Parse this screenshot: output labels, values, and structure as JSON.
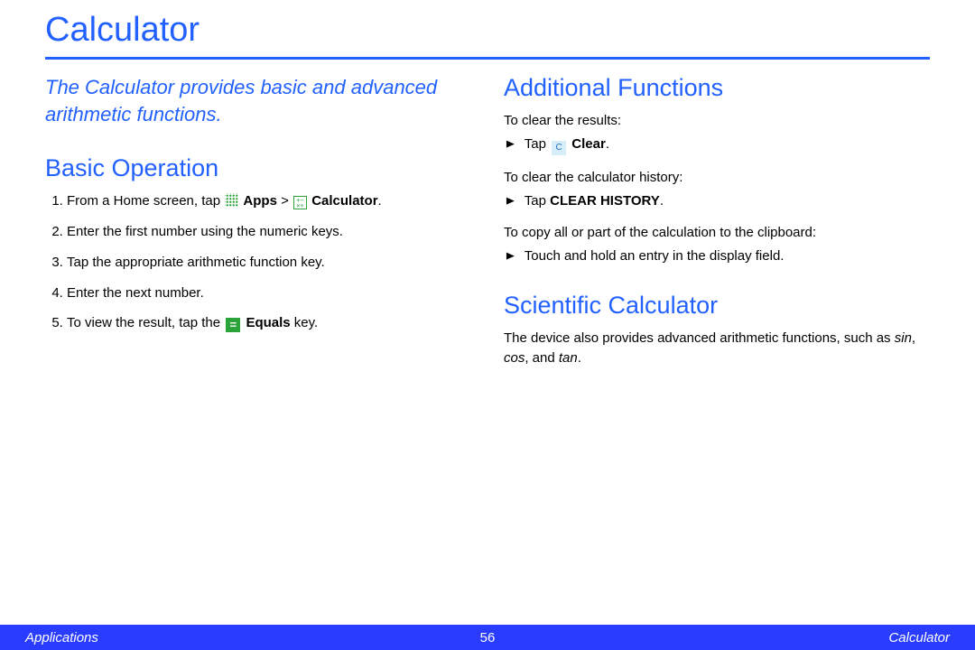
{
  "title": "Calculator",
  "intro": "The Calculator provides basic and advanced arithmetic functions.",
  "basic": {
    "heading": "Basic Operation",
    "step1_a": "From a Home screen, tap ",
    "step1_apps": "Apps",
    "step1_gt": " > ",
    "step1_calc": "Calculator",
    "step1_end": ".",
    "step2": "Enter the first number using the numeric keys.",
    "step3": "Tap the appropriate arithmetic function key.",
    "step4": "Enter the next number.",
    "step5_a": "To view the result, tap the ",
    "step5_equals": "Equals",
    "step5_b": " key."
  },
  "additional": {
    "heading": "Additional Functions",
    "clear_results": "To clear the results:",
    "tap": "Tap ",
    "clear_label": "Clear",
    "period": ".",
    "clear_history_intro": "To clear the calculator history:",
    "clear_history_label": "CLEAR HISTORY",
    "copy_intro": "To copy all or part of the calculation to the clipboard:",
    "copy_action": "Touch and hold an entry in the display field."
  },
  "scientific": {
    "heading": "Scientific Calculator",
    "body_a": "The device also provides advanced arithmetic functions, such as ",
    "sin": "sin",
    "sep1": ", ",
    "cos": "cos",
    "sep2": ", and ",
    "tan": "tan",
    "end": "."
  },
  "footer": {
    "left": "Applications",
    "center": "56",
    "right": "Calculator"
  }
}
